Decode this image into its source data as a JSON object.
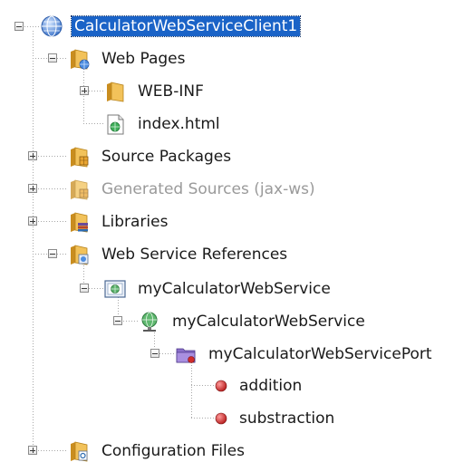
{
  "tree": {
    "root": {
      "label": "CalculatorWebServiceClient1",
      "icon": "globe-icon",
      "selected": true
    },
    "web_pages": {
      "label": "Web Pages",
      "icon": "web-folder-icon"
    },
    "web_inf": {
      "label": "WEB-INF",
      "icon": "folder-icon"
    },
    "index_html": {
      "label": "index.html",
      "icon": "html-file-icon"
    },
    "source_packages": {
      "label": "Source Packages",
      "icon": "package-folder-icon"
    },
    "generated_sources": {
      "label": "Generated Sources (jax-ws)",
      "icon": "package-folder-icon"
    },
    "libraries": {
      "label": "Libraries",
      "icon": "library-folder-icon"
    },
    "ws_references": {
      "label": "Web Service References",
      "icon": "ws-folder-icon"
    },
    "ws_ref_item": {
      "label": "myCalculatorWebService",
      "icon": "web-service-reference-icon"
    },
    "service": {
      "label": "myCalculatorWebService",
      "icon": "service-globe-icon"
    },
    "port": {
      "label": "myCalculatorWebServicePort",
      "icon": "port-folder-icon"
    },
    "op_addition": {
      "label": "addition",
      "icon": "operation-icon"
    },
    "op_substraction": {
      "label": "substraction",
      "icon": "operation-icon"
    },
    "config_files": {
      "label": "Configuration Files",
      "icon": "config-folder-icon"
    }
  },
  "colors": {
    "selection": "#1a63c7",
    "muted_text": "#9a9a9a",
    "folder": "#e9b84a",
    "operation": "#d12c2c"
  }
}
